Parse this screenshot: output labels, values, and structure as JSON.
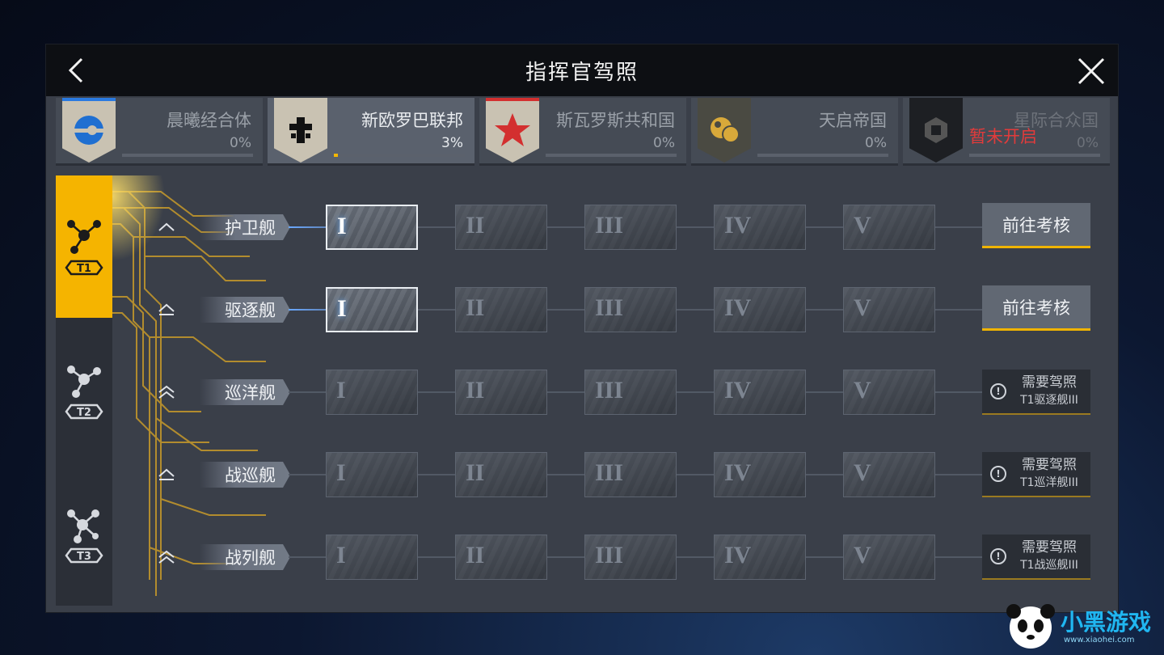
{
  "window": {
    "title": "指挥官驾照"
  },
  "factions": [
    {
      "name": "晨曦经合体",
      "percent": "0%",
      "progress": 0,
      "stripe": "#2a7ae0",
      "emblem_color": "#1f6fd1",
      "active": false,
      "locked_label": ""
    },
    {
      "name": "新欧罗巴联邦",
      "percent": "3%",
      "progress": 0.03,
      "stripe": "#c9c2b2",
      "emblem_color": "#111111",
      "active": true,
      "locked_label": ""
    },
    {
      "name": "斯瓦罗斯共和国",
      "percent": "0%",
      "progress": 0,
      "stripe": "#d32f2f",
      "emblem_color": "#d32f2f",
      "active": false,
      "locked_label": ""
    },
    {
      "name": "天启帝国",
      "percent": "0%",
      "progress": 0,
      "stripe": "#b8902c",
      "emblem_color": "#d8a93a",
      "active": false,
      "locked_label": ""
    },
    {
      "name": "星际合众国",
      "percent": "0%",
      "progress": 0,
      "stripe": "#333333",
      "emblem_color": "#555555",
      "active": false,
      "locked_label": "暂未开启"
    }
  ],
  "tiers": [
    {
      "label": "T1",
      "active": true
    },
    {
      "label": "T2",
      "active": false
    },
    {
      "label": "T3",
      "active": false
    }
  ],
  "levels": [
    "I",
    "II",
    "III",
    "IV",
    "V"
  ],
  "ship_rows": [
    {
      "name": "护卫舰",
      "unlocked_levels": 1,
      "action": "前往考核",
      "requirement": null
    },
    {
      "name": "驱逐舰",
      "unlocked_levels": 1,
      "action": "前往考核",
      "requirement": null
    },
    {
      "name": "巡洋舰",
      "unlocked_levels": 0,
      "action": null,
      "requirement": {
        "line1": "需要驾照",
        "line2": "T1驱逐舰III"
      }
    },
    {
      "name": "战巡舰",
      "unlocked_levels": 0,
      "action": null,
      "requirement": {
        "line1": "需要驾照",
        "line2": "T1巡洋舰III"
      }
    },
    {
      "name": "战列舰",
      "unlocked_levels": 0,
      "action": null,
      "requirement": {
        "line1": "需要驾照",
        "line2": "T1战巡舰III"
      }
    }
  ],
  "watermark": {
    "text": "小黑游戏",
    "sub": "www.xiaohei.com"
  }
}
